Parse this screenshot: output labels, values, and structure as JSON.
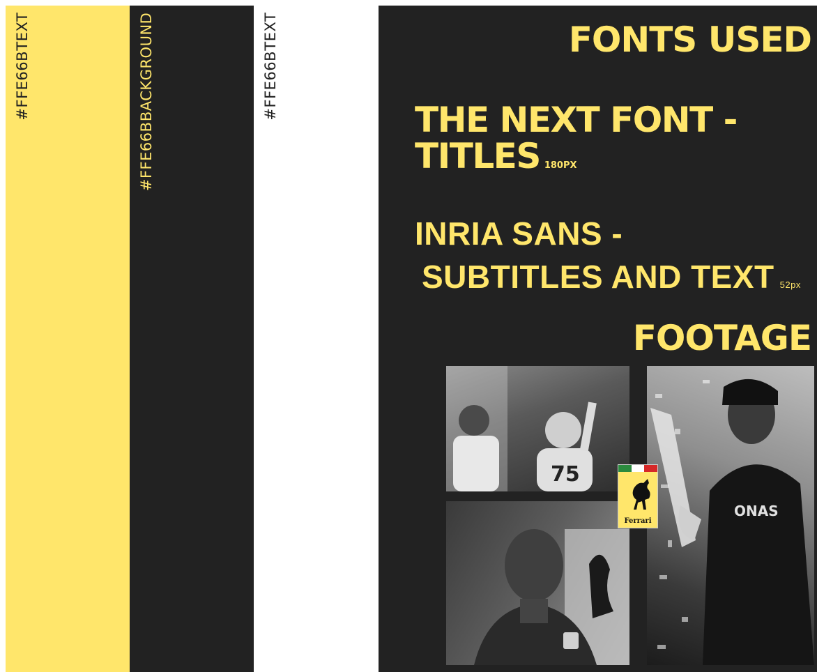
{
  "swatches": [
    {
      "hex": "#FFE66B",
      "role": "TEXT",
      "color": "#FFE66B"
    },
    {
      "hex": "#FFE66B",
      "role": "BACKGROUND",
      "color": "#222222"
    },
    {
      "hex": "#FFE66B",
      "role": "TEXT",
      "color": "#FFFFFF"
    }
  ],
  "fonts": {
    "title": "FONTS USED",
    "font1_line1": "THE NEXT FONT -",
    "font1_line2": "TITLES",
    "font1_size": "180PX",
    "font2_line1": "INRIA SANS -",
    "font2_line2": "SUBTITLES AND TEXT",
    "font2_size": "52px"
  },
  "footage": {
    "title": "FOOTAGE",
    "badge_text": "Ferrari"
  },
  "colors": {
    "accent": "#FFE66B",
    "dark": "#222222",
    "white": "#FFFFFF"
  }
}
